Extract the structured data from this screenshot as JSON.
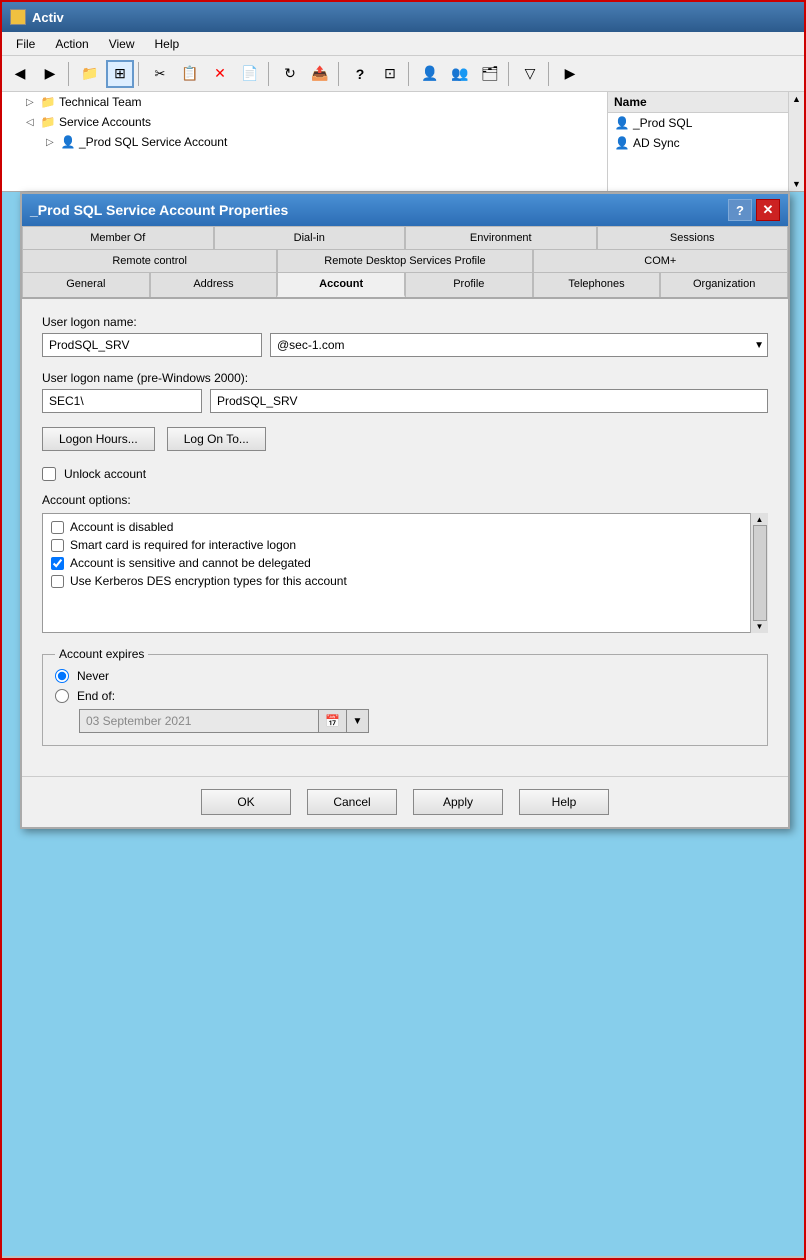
{
  "titleBar": {
    "icon": "■",
    "title": "Activ"
  },
  "menuBar": {
    "items": [
      "File",
      "Action",
      "View",
      "Help"
    ]
  },
  "toolbar": {
    "buttons": [
      {
        "name": "back",
        "icon": "←"
      },
      {
        "name": "forward",
        "icon": "→"
      },
      {
        "name": "browse",
        "icon": "📁"
      },
      {
        "name": "grid",
        "icon": "⊞"
      },
      {
        "name": "cut",
        "icon": "✂"
      },
      {
        "name": "copy",
        "icon": "📋"
      },
      {
        "name": "delete",
        "icon": "✕"
      },
      {
        "name": "move",
        "icon": "📄"
      },
      {
        "name": "refresh",
        "icon": "↻"
      },
      {
        "name": "export",
        "icon": "📤"
      },
      {
        "name": "help",
        "icon": "?"
      },
      {
        "name": "view2",
        "icon": "⊡"
      },
      {
        "name": "user-add",
        "icon": "👤"
      },
      {
        "name": "users",
        "icon": "👥"
      },
      {
        "name": "folder2",
        "icon": "🗂"
      },
      {
        "name": "filter",
        "icon": "▽"
      },
      {
        "name": "more",
        "icon": "▶"
      }
    ]
  },
  "tree": {
    "items": [
      {
        "label": "Technical Team",
        "indent": 1,
        "type": "folder",
        "expand": "▷"
      },
      {
        "label": "Service Accounts",
        "indent": 1,
        "type": "folder",
        "expand": "◁"
      },
      {
        "label": "_Prod SQL Service Account",
        "indent": 2,
        "type": "user",
        "expand": "▷"
      }
    ]
  },
  "namePanel": {
    "header": "Name",
    "items": [
      {
        "label": "_Prod SQL",
        "icon": "user"
      },
      {
        "label": "AD Sync",
        "icon": "user"
      }
    ]
  },
  "dialog": {
    "title": "_Prod SQL Service Account Properties",
    "helpBtn": "?",
    "closeBtn": "✕",
    "tabs": {
      "row1": [
        "Member Of",
        "Dial-in",
        "Environment",
        "Sessions"
      ],
      "row2": [
        "Remote control",
        "Remote Desktop Services Profile",
        "COM+"
      ],
      "row3": [
        "General",
        "Address",
        "Account",
        "Profile",
        "Telephones",
        "Organization"
      ]
    },
    "activeTab": "Account",
    "form": {
      "userLogonLabel": "User logon name:",
      "userLogonValue": "ProdSQL_SRV",
      "domainValue": "@sec-1.com",
      "domainOptions": [
        "@sec-1.com"
      ],
      "userLogonPreLabel": "User logon name (pre-Windows 2000):",
      "preWin2kDomain": "SEC1\\",
      "preWin2kUser": "ProdSQL_SRV",
      "logonHoursBtn": "Logon Hours...",
      "logOnToBtn": "Log On To...",
      "unlockLabel": "Unlock account",
      "unlockChecked": false,
      "accountOptionsLabel": "Account options:",
      "options": [
        {
          "label": "Account is disabled",
          "checked": false
        },
        {
          "label": "Smart card is required for interactive logon",
          "checked": false
        },
        {
          "label": "Account is sensitive and cannot be delegated",
          "checked": true
        },
        {
          "label": "Use Kerberos DES encryption types for this account",
          "checked": false
        }
      ],
      "accountExpiresLabel": "Account expires",
      "neverLabel": "Never",
      "neverSelected": true,
      "endOfLabel": "End of:",
      "endOfDate": "03 September 2021"
    },
    "footer": {
      "ok": "OK",
      "cancel": "Cancel",
      "apply": "Apply",
      "help": "Help"
    }
  }
}
